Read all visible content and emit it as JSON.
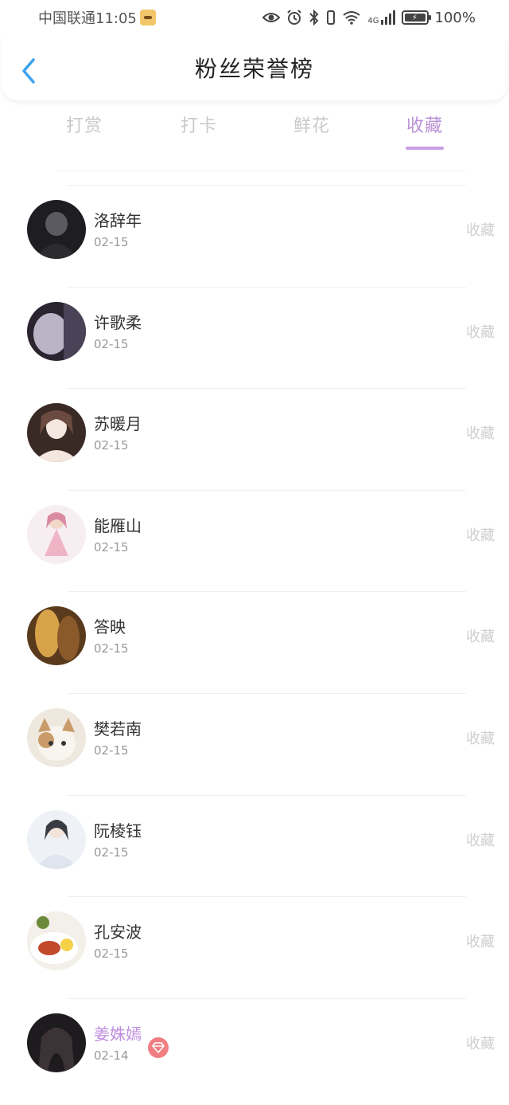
{
  "status_bar": {
    "carrier_time": "中国联通11:05",
    "network": "4G",
    "battery_text": "100%"
  },
  "header": {
    "title": "粉丝荣誉榜"
  },
  "tabs": [
    {
      "label": "打赏",
      "active": false
    },
    {
      "label": "打卡",
      "active": false
    },
    {
      "label": "鲜花",
      "active": false
    },
    {
      "label": "收藏",
      "active": true
    }
  ],
  "list": [
    {
      "name": "洛辞年",
      "date": "02-15",
      "action": "收藏",
      "vip": false,
      "avatar_colors": [
        "#1e1e22",
        "#5a5a60",
        "#2b2b30"
      ]
    },
    {
      "name": "许歌柔",
      "date": "02-15",
      "action": "收藏",
      "vip": false,
      "avatar_colors": [
        "#2a2330",
        "#b9b4c6",
        "#4a4256"
      ]
    },
    {
      "name": "苏暖月",
      "date": "02-15",
      "action": "收藏",
      "vip": false,
      "avatar_colors": [
        "#3a2a26",
        "#f4e7df",
        "#6b4a40"
      ]
    },
    {
      "name": "能雁山",
      "date": "02-15",
      "action": "收藏",
      "vip": false,
      "avatar_colors": [
        "#f7eef1",
        "#efb5c6",
        "#d98aa2"
      ]
    },
    {
      "name": "答映",
      "date": "02-15",
      "action": "收藏",
      "vip": false,
      "avatar_colors": [
        "#5a3a1c",
        "#d6a24a",
        "#8b5a2b"
      ]
    },
    {
      "name": "樊若南",
      "date": "02-15",
      "action": "收藏",
      "vip": false,
      "avatar_colors": [
        "#efe8df",
        "#c99b69",
        "#f8f4ee"
      ]
    },
    {
      "name": "阮棱钰",
      "date": "02-15",
      "action": "收藏",
      "vip": false,
      "avatar_colors": [
        "#eef1f6",
        "#3a3a44",
        "#dfe4ee"
      ]
    },
    {
      "name": "孔安波",
      "date": "02-15",
      "action": "收藏",
      "vip": false,
      "avatar_colors": [
        "#f3efe9",
        "#c24a2a",
        "#6b8b3a"
      ]
    },
    {
      "name": "姜姝嫣",
      "date": "02-14",
      "action": "收藏",
      "vip": true,
      "avatar_colors": [
        "#1d1b1d",
        "#e8d8ce",
        "#3b3336"
      ]
    }
  ],
  "colors": {
    "accent": "#b98fd6",
    "back_arrow": "#3ba3ee",
    "vip_badge": "#f07e82",
    "inactive_tab": "#c9c9c9"
  }
}
